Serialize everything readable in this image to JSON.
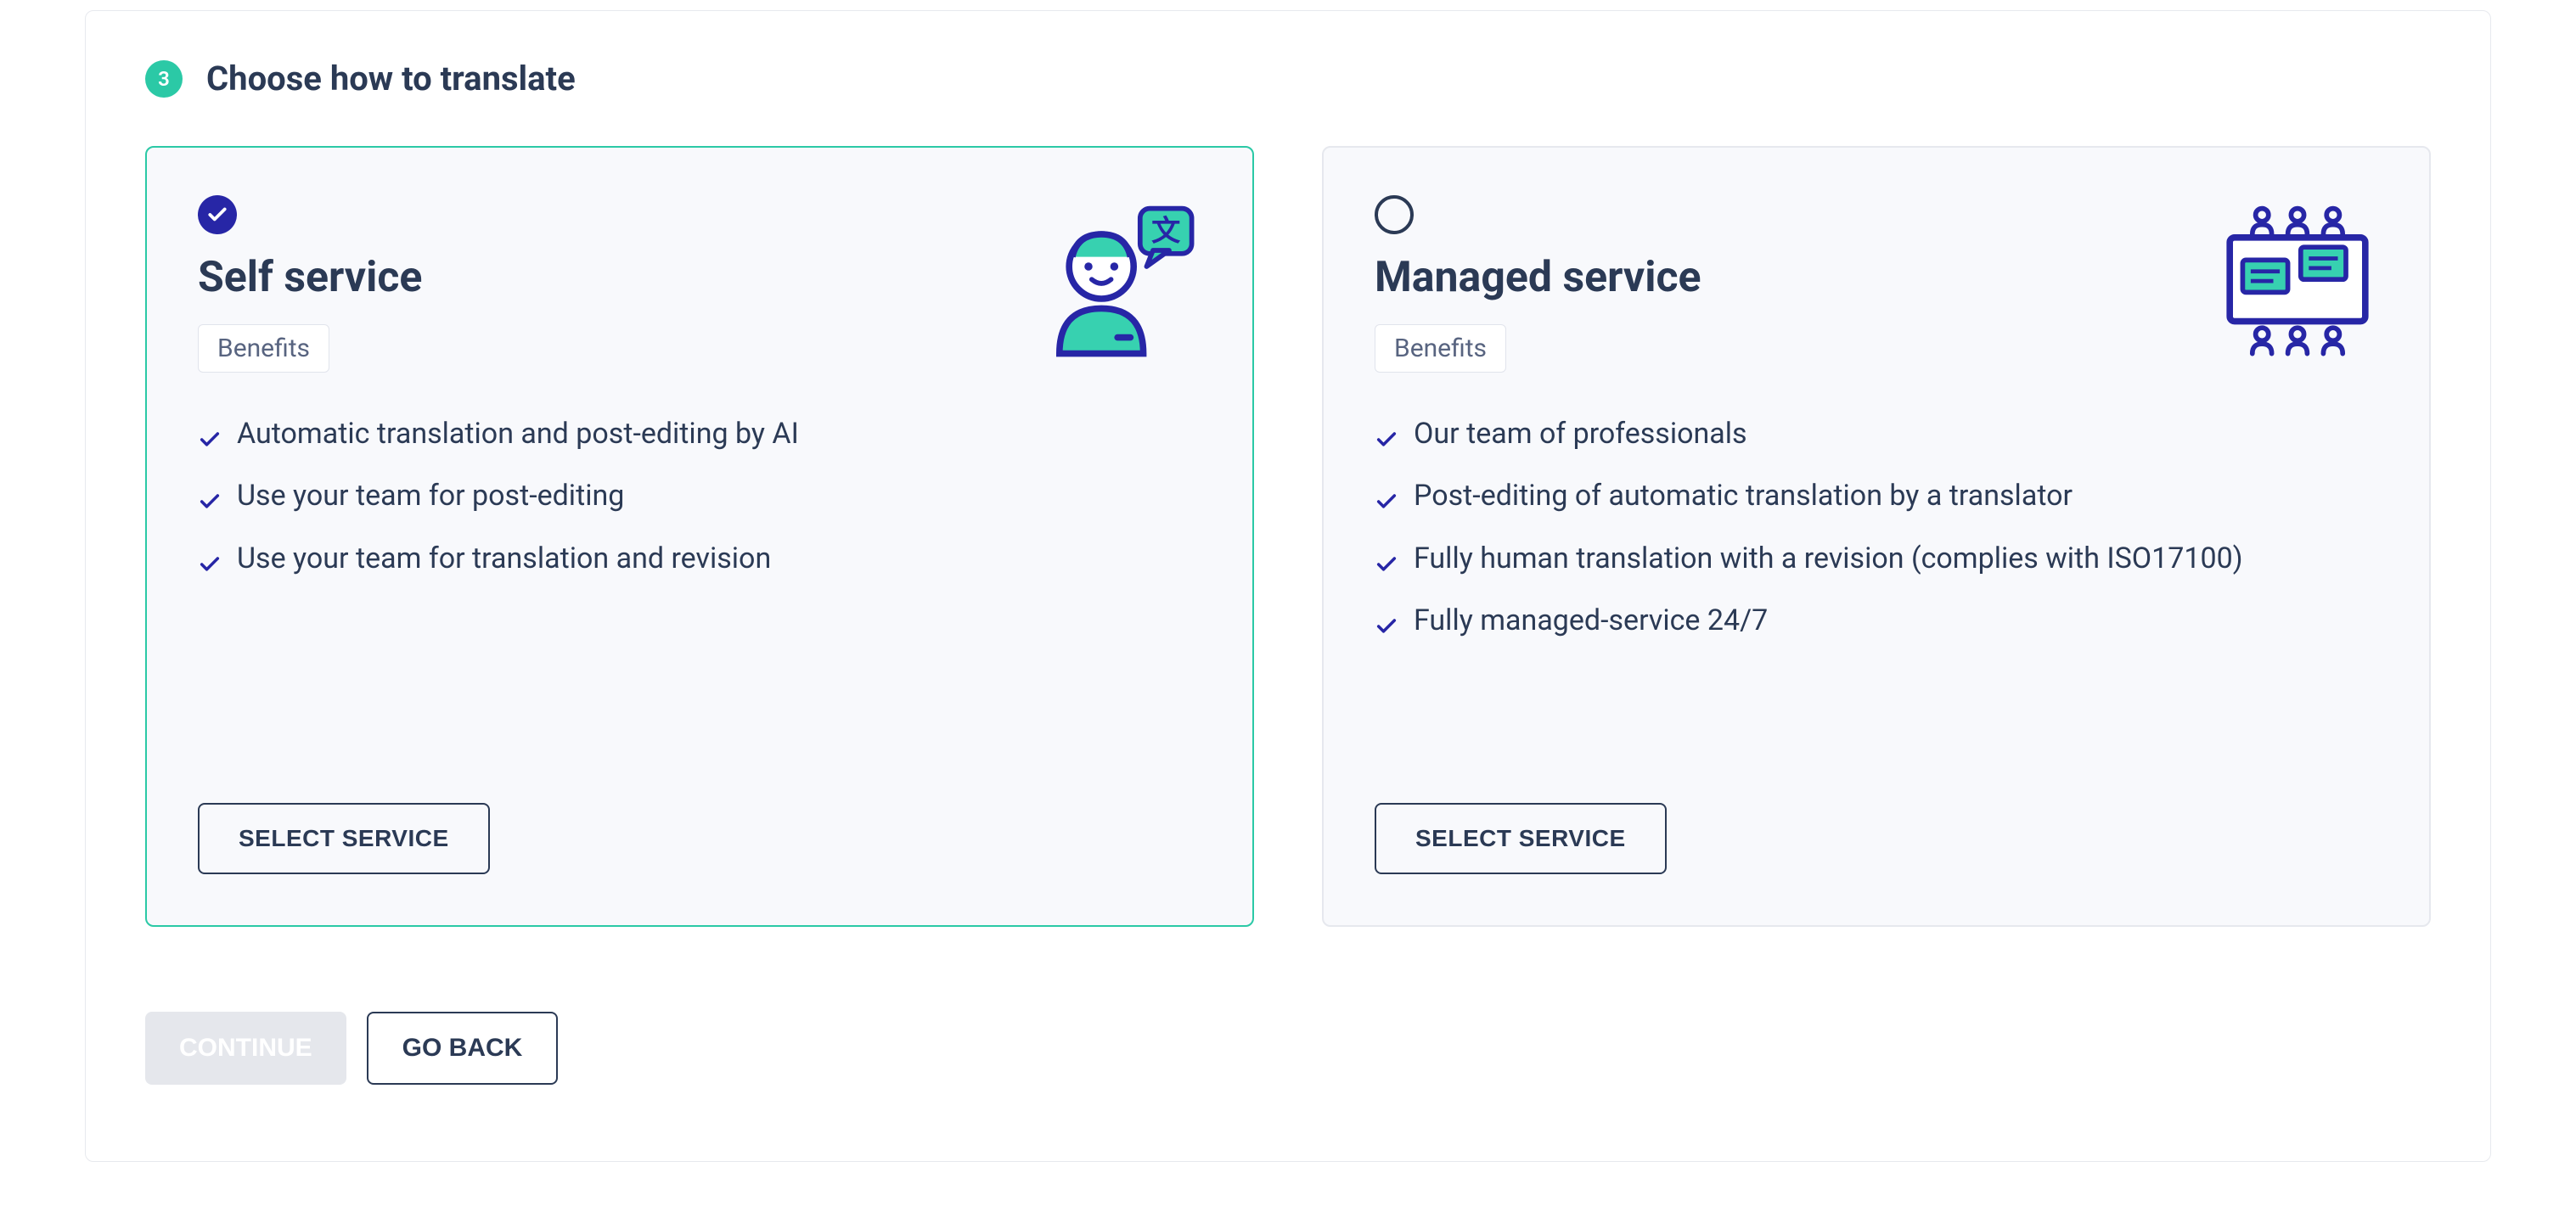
{
  "section": {
    "step_number": "3",
    "title": "Choose how to translate"
  },
  "cards": [
    {
      "selected": true,
      "title": "Self service",
      "benefits_label": "Benefits",
      "benefits": [
        "Automatic translation and post-editing by AI",
        "Use your team for post-editing",
        "Use your team for translation and revision"
      ],
      "select_label": "SELECT SERVICE",
      "illustration": "person-translate-icon"
    },
    {
      "selected": false,
      "title": "Managed service",
      "benefits_label": "Benefits",
      "benefits": [
        "Our team of professionals",
        "Post-editing of automatic translation by a translator",
        "Fully human translation with a revision (complies with ISO17100)",
        "Fully managed-service 24/7"
      ],
      "select_label": "SELECT SERVICE",
      "illustration": "team-board-icon"
    }
  ],
  "footer": {
    "continue_label": "CONTINUE",
    "goback_label": "GO BACK"
  }
}
